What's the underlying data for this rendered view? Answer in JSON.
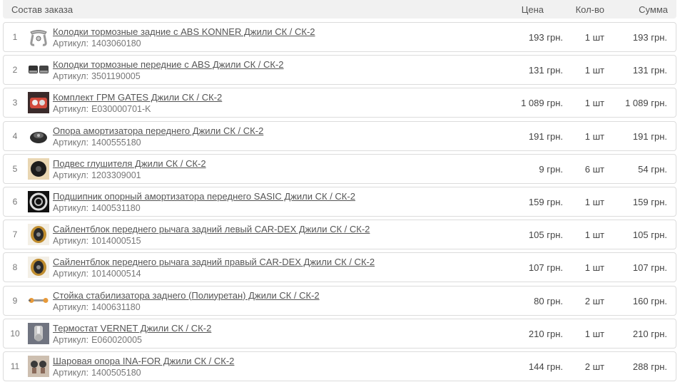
{
  "header": {
    "title": "Состав заказа",
    "price": "Цена",
    "qty": "Кол-во",
    "sum": "Сумма"
  },
  "article_label": "Артикул:",
  "items": [
    {
      "n": "1",
      "title": "Колодки тормозные задние с ABS KONNER Джили СК / СК-2",
      "article": "1403060180",
      "price": "193 грн.",
      "qty": "1 шт",
      "sum": "193 грн.",
      "icon": "brake-bracket-icon"
    },
    {
      "n": "2",
      "title": "Колодки тормозные передние с ABS Джили СК / СК-2",
      "article": "3501190005",
      "price": "131 грн.",
      "qty": "1 шт",
      "sum": "131 грн.",
      "icon": "brake-pads-icon"
    },
    {
      "n": "3",
      "title": "Комплект ГРМ GATES Джили СК / СК-2",
      "article": "E030000701-K",
      "price": "1 089 грн.",
      "qty": "1 шт",
      "sum": "1 089 грн.",
      "icon": "timing-kit-icon"
    },
    {
      "n": "4",
      "title": "Опора амортизатора переднего Джили СК / СК-2",
      "article": "1400555180",
      "price": "191 грн.",
      "qty": "1 шт",
      "sum": "191 грн.",
      "icon": "strut-mount-icon"
    },
    {
      "n": "5",
      "title": "Подвес глушителя Джили СК / СК-2",
      "article": "1203309001",
      "price": "9 грн.",
      "qty": "6 шт",
      "sum": "54 грн.",
      "icon": "muffler-hanger-icon"
    },
    {
      "n": "6",
      "title": "Подшипник опорный амортизатора переднего SASIC Джили СК / СК-2",
      "article": "1400531180",
      "price": "159 грн.",
      "qty": "1 шт",
      "sum": "159 грн.",
      "icon": "bearing-icon"
    },
    {
      "n": "7",
      "title": "Сайлентблок переднего рычага задний левый CAR-DEX Джили СК / СК-2",
      "article": "1014000515",
      "price": "105 грн.",
      "qty": "1 шт",
      "sum": "105 грн.",
      "icon": "silent-block-icon"
    },
    {
      "n": "8",
      "title": "Сайлентблок переднего рычага задний правый CAR-DEX Джили СК / СК-2",
      "article": "1014000514",
      "price": "107 грн.",
      "qty": "1 шт",
      "sum": "107 грн.",
      "icon": "silent-block-icon"
    },
    {
      "n": "9",
      "title": "Стойка стабилизатора заднего (Полиуретан) Джили СК / СК-2",
      "article": "1400631180",
      "price": "80 грн.",
      "qty": "2 шт",
      "sum": "160 грн.",
      "icon": "stabilizer-link-icon"
    },
    {
      "n": "10",
      "title": "Термостат VERNET Джили СК / СК-2",
      "article": "E060020005",
      "price": "210 грн.",
      "qty": "1 шт",
      "sum": "210 грн.",
      "icon": "thermostat-icon"
    },
    {
      "n": "11",
      "title": "Шаровая опора INA-FOR Джили СК / СК-2",
      "article": "1400505180",
      "price": "144 грн.",
      "qty": "2 шт",
      "sum": "288 грн.",
      "icon": "ball-joint-icon"
    }
  ]
}
